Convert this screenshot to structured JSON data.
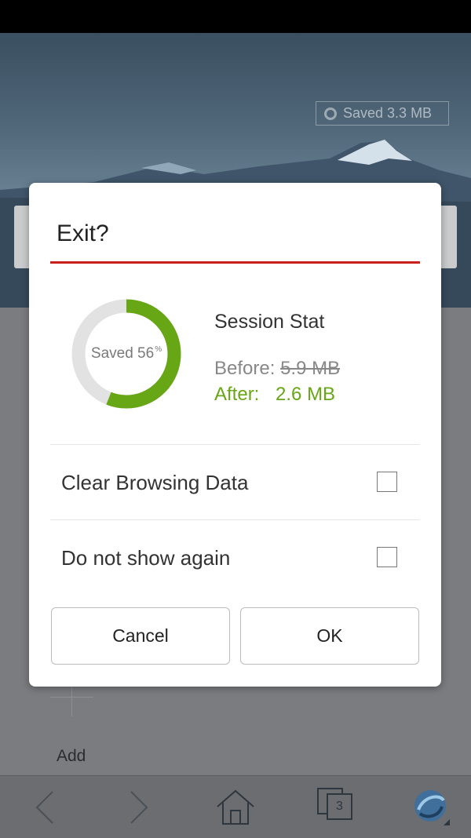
{
  "background": {
    "saved_chip": "Saved 3.3 MB",
    "add_label": "Add",
    "tab_count": "3"
  },
  "dialog": {
    "title": "Exit?",
    "donut": {
      "label": "Saved 56",
      "percent_sign": "%",
      "saved_fraction": 0.56,
      "color_saved": "#67a614",
      "color_track": "#e2e2e2"
    },
    "session": {
      "title": "Session Stat",
      "before_label": "Before:",
      "before_value": "5.9 MB",
      "after_label": "After:",
      "after_value": "2.6 MB"
    },
    "options": [
      {
        "label": "Clear Browsing Data",
        "checked": false
      },
      {
        "label": "Do not show again",
        "checked": false
      }
    ],
    "cancel_label": "Cancel",
    "ok_label": "OK"
  },
  "colors": {
    "accent_rule": "#c9201c",
    "after_text": "#67a614"
  },
  "icons": [
    "back-icon",
    "forward-icon",
    "home-icon",
    "tabs-icon",
    "menu-globe-icon"
  ]
}
